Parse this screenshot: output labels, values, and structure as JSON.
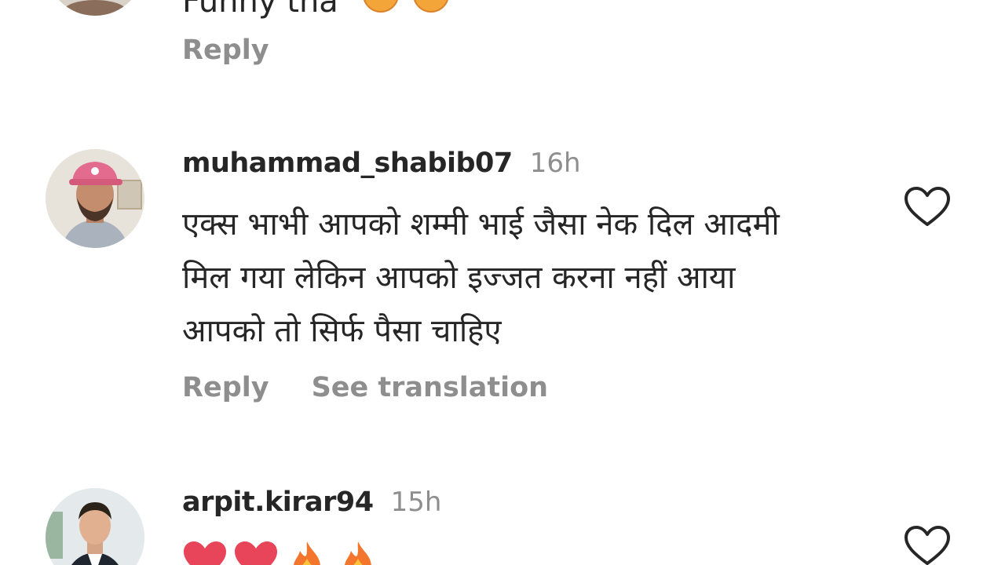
{
  "comments": [
    {
      "text": "Funny tha",
      "reply_label": "Reply",
      "emojis": [
        "laughing-face",
        "laughing-face"
      ]
    },
    {
      "username": "muhammad_shabib07",
      "timestamp": "16h",
      "text": "एक्स भाभी आपको शम्मी भाई जैसा नेक दिल आदमी मिल गया लेकिन आपको इज्जत करना नहीं आया आपको तो सिर्फ पैसा चाहिए",
      "reply_label": "Reply",
      "translate_label": "See translation"
    },
    {
      "username": "arpit.kirar94",
      "timestamp": "15h",
      "emojis": [
        "red-heart",
        "red-heart",
        "fire",
        "fire"
      ]
    }
  ],
  "colors": {
    "text": "#262626",
    "secondary": "#8e8e8e",
    "background": "#ffffff"
  },
  "icons": {
    "like": "heart-outline-icon"
  }
}
